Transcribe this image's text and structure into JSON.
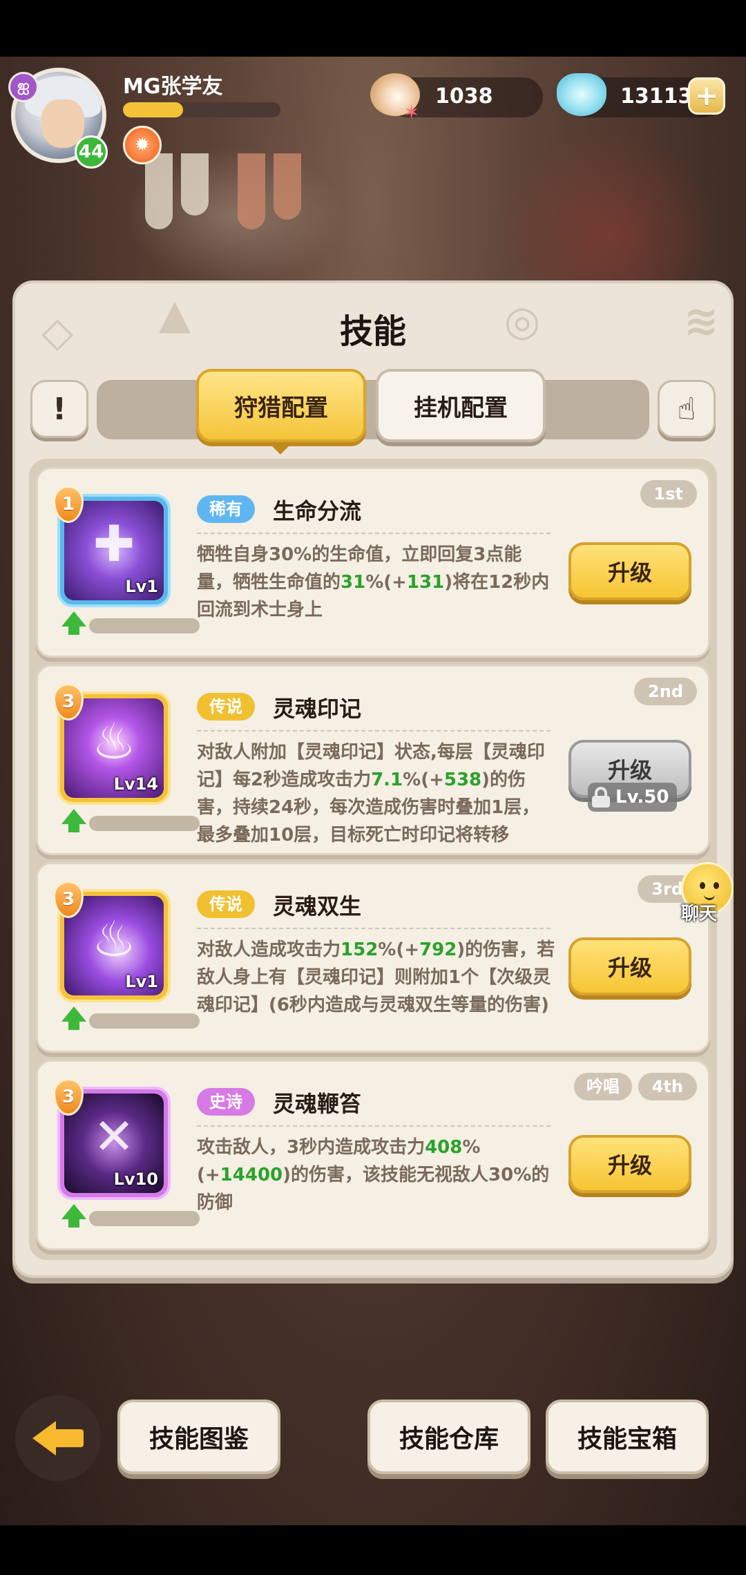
{
  "header": {
    "player_name": "MG张学友",
    "vip_symbol": "ஐ",
    "level": "44",
    "exp_fraction": 0.38,
    "resources": [
      {
        "icon": "pearl-icon",
        "value": "1038"
      },
      {
        "icon": "crystal-icon",
        "value": "13113"
      }
    ],
    "plus_symbol": "+"
  },
  "panel": {
    "title": "技能",
    "info_symbol": "!",
    "hand_symbol": "☝",
    "tabs": [
      {
        "label": "狩猎配置",
        "active": true
      },
      {
        "label": "挂机配置",
        "active": false
      }
    ]
  },
  "skills": [
    {
      "star": "1",
      "level": "Lv1",
      "glyph": "✚",
      "rarity": "稀有",
      "rarity_color": "#5fb6f0",
      "name": "生命分流",
      "rank": "1st",
      "desc_parts": [
        "牺牲自身30%的生命值，立即回复3点能量，牺牲生命值的",
        "31",
        "%(+",
        "131",
        ")将在12秒内回流到术士身上"
      ],
      "button": "升级"
    },
    {
      "star": "3",
      "level": "Lv14",
      "glyph": "♨",
      "rarity": "传说",
      "rarity_color": "#f0c030",
      "name": "灵魂印记",
      "rank": "2nd",
      "desc_parts": [
        "对敌人附加【灵魂印记】状态,每层【灵魂印记】每2秒造成攻击力",
        "7.1",
        "%(+",
        "538",
        ")的伤害，持续24秒，每次造成伤害时叠加1层，最多叠加10层，目标死亡时印记将转移"
      ],
      "button": "升级",
      "lock_text": "Lv.50"
    },
    {
      "star": "3",
      "level": "Lv1",
      "glyph": "♨",
      "rarity": "传说",
      "rarity_color": "#f0c030",
      "name": "灵魂双生",
      "rank": "3rd",
      "desc_parts": [
        "对敌人造成攻击力",
        "152",
        "%(+",
        "792",
        ")的伤害，若敌人身上有【灵魂印记】则附加1个【次级灵魂印记】(6秒内造成与灵魂双生等量的伤害)"
      ],
      "button": "升级"
    },
    {
      "star": "3",
      "level": "Lv10",
      "glyph": "✕",
      "rarity": "史诗",
      "rarity_color": "#d87ae6",
      "name": "灵魂鞭笞",
      "chant": "吟唱",
      "rank": "4th",
      "desc_parts": [
        "攻击敌人，3秒内造成攻击力",
        "408",
        "%(+",
        "14400",
        ")的伤害，该技能无视敌人30%的防御"
      ],
      "button": "升级"
    }
  ],
  "chat": {
    "label": "聊天"
  },
  "bottom": {
    "buttons": [
      "技能图鉴",
      "技能仓库",
      "技能宝箱"
    ]
  }
}
